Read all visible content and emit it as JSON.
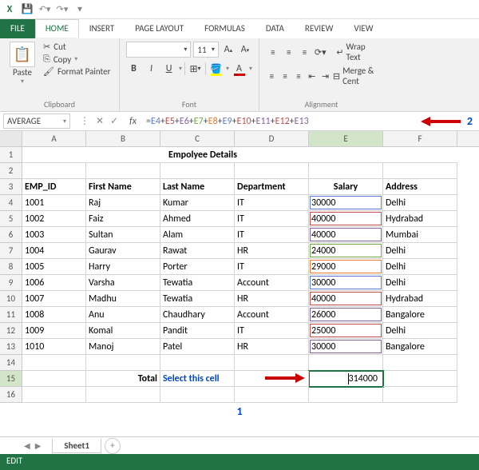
{
  "tabs": {
    "file": "FILE",
    "home": "HOME",
    "insert": "INSERT",
    "pagelayout": "PAGE LAYOUT",
    "formulas": "FORMULAS",
    "data": "DATA",
    "review": "REVIEW",
    "view": "VIEW"
  },
  "clipboard": {
    "paste": "Paste",
    "cut": "Cut",
    "copy": "Copy",
    "format_painter": "Format Painter",
    "group": "Clipboard"
  },
  "font": {
    "size": "11",
    "bold": "B",
    "italic": "I",
    "underline": "U",
    "group": "Font"
  },
  "alignment": {
    "wrap": "Wrap Text",
    "merge": "Merge & Cent",
    "group": "Alignment"
  },
  "namebox": "AVERAGE",
  "formula": {
    "prefix": "=",
    "refs": [
      "E4",
      "E5",
      "E6",
      "E7",
      "E8",
      "E9",
      "E10",
      "E11",
      "E12",
      "E13"
    ]
  },
  "annot": {
    "one": "1",
    "two": "2",
    "select": "Select this cell"
  },
  "cols": [
    "A",
    "B",
    "C",
    "D",
    "E",
    "F"
  ],
  "title": "Empolyee Details",
  "headers": {
    "emp": "EMP_ID",
    "first": "First Name",
    "last": "Last Name",
    "dept": "Department",
    "sal": "Salary",
    "addr": "Address"
  },
  "rows": [
    {
      "id": "1001",
      "f": "Raj",
      "l": "Kumar",
      "d": "IT",
      "s": "30000",
      "a": "Delhi",
      "c": "#5b7bd5"
    },
    {
      "id": "1002",
      "f": "Faiz",
      "l": "Ahmed",
      "d": "IT",
      "s": "40000",
      "a": "Hydrabad",
      "c": "#c0504d"
    },
    {
      "id": "1003",
      "f": "Sultan",
      "l": "Alam",
      "d": "IT",
      "s": "40000",
      "a": "Mumbai",
      "c": "#8064a2"
    },
    {
      "id": "1004",
      "f": "Gaurav",
      "l": "Rawat",
      "d": "HR",
      "s": "24000",
      "a": "Delhi",
      "c": "#70ad47"
    },
    {
      "id": "1005",
      "f": "Harry",
      "l": "Porter",
      "d": "IT",
      "s": "29000",
      "a": "Delhi",
      "c": "#ed7d31"
    },
    {
      "id": "1006",
      "f": "Varsha",
      "l": "Tewatia",
      "d": "Account",
      "s": "30000",
      "a": "Delhi",
      "c": "#5b7bd5"
    },
    {
      "id": "1007",
      "f": "Madhu",
      "l": "Tewatia",
      "d": "HR",
      "s": "40000",
      "a": "Hydrabad",
      "c": "#c0504d"
    },
    {
      "id": "1008",
      "f": "Anu",
      "l": "Chaudhary",
      "d": "Account",
      "s": "26000",
      "a": "Bangalore",
      "c": "#8064a2"
    },
    {
      "id": "1009",
      "f": "Komal",
      "l": "Pandit",
      "d": "IT",
      "s": "25000",
      "a": "Delhi",
      "c": "#c0504d"
    },
    {
      "id": "1010",
      "f": "Manoj",
      "l": "Patel",
      "d": "HR",
      "s": "30000",
      "a": "Bangalore",
      "c": "#8064a2"
    }
  ],
  "total_label": "Total",
  "total_value": "314000",
  "sheet": "Sheet1",
  "status": "EDIT"
}
